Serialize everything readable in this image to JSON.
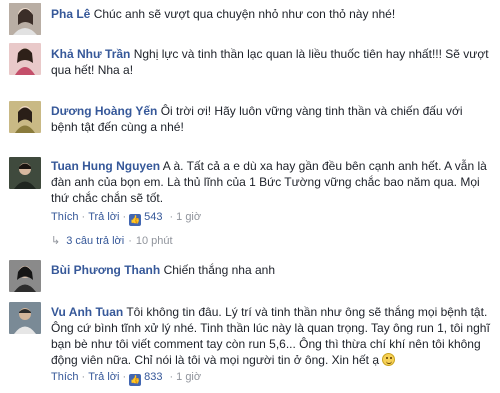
{
  "comments": [
    {
      "name": "Pha Lê",
      "text": "Chúc anh sẽ vượt qua chuyện nhỏ như con thỏ này nhé!",
      "avatar_color": "#9b8f86"
    },
    {
      "name": "Khả Như Trần",
      "text": "Nghị lực và tinh thần lạc quan là liều thuốc tiên hay nhất!!! Sẽ vượt qua hết! Nha a!",
      "avatar_color": "#c88a8a"
    },
    {
      "name": "Dương Hoàng Yến",
      "text": "Ôi trời ơi! Hãy luôn vững vàng tinh thần và chiến đấu với bệnh tật đến cùng a nhé!",
      "avatar_color": "#b7a56a"
    },
    {
      "name": "Tuan Hung Nguyen",
      "text": "A à. Tất cả a e dù xa hay gần đều bên cạnh anh hết. A vẫn là đàn anh của bọn em. Là thủ lĩnh của 1 Bức Tường vững chắc bao năm qua. Mọi thứ chắc chắn sẽ tốt.",
      "like_label": "Thích",
      "reply_label": "Trả lời",
      "like_count": "543",
      "time": "1 giờ",
      "replies_label": "3 câu trả lời",
      "replies_time": "10 phút",
      "avatar_color": "#4d5a4a"
    },
    {
      "name": "Bùi Phương Thanh",
      "text": "Chiến thắng nha anh",
      "avatar_color": "#6e6e6e"
    },
    {
      "name": "Vu Anh Tuan",
      "text": "Tôi không tin đâu. Lý trí và tinh thần như ông sẽ thắng mọi bệnh tật. Ông cứ bình tĩnh xử lý nhé. Tinh thần lúc này là quan trọng. Tay ông run 1, tôi nghĩ bạn bè như tôi viết comment tay còn run 5,6... Ông thì thừa chí khí nên tôi không động viên nữa. Chỉ nói là tôi và mọi người tin ở ông. Xin hết ạ",
      "like_label": "Thích",
      "reply_label": "Trả lời",
      "like_count": "833",
      "time": "1 giờ",
      "avatar_color": "#5a6a7a"
    }
  ],
  "icons": {
    "like": "thumbs-up-icon",
    "reply_arrow": "reply-arrow-icon",
    "emoji": "smile-emoji-icon"
  },
  "colors": {
    "name_link": "#365899",
    "meta_gray": "#90949c",
    "like_badge": "#4267b2"
  }
}
